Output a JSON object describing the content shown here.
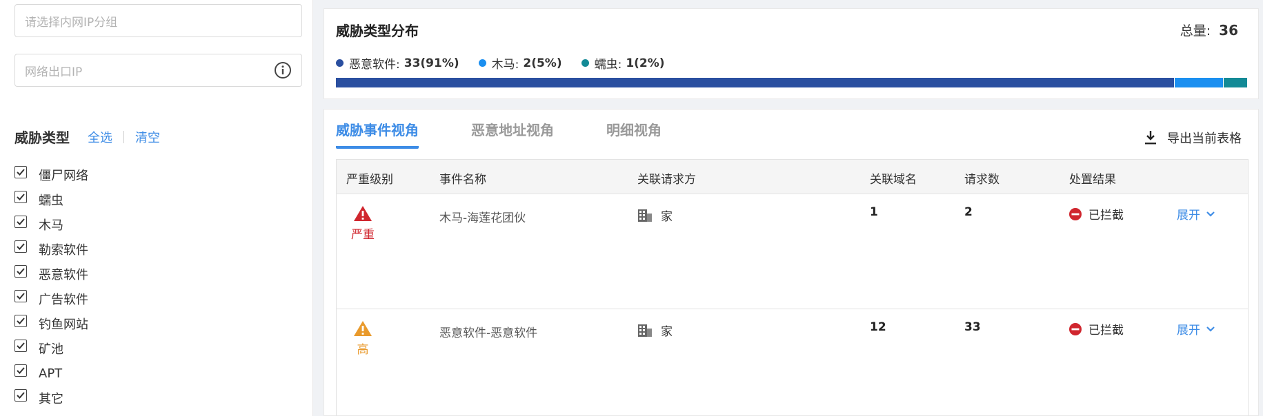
{
  "left_panel": {
    "ip_group_placeholder": "请选择内网IP分组",
    "egress_ip_placeholder": "网络出口IP",
    "filter_title": "威胁类型",
    "select_all": "全选",
    "clear": "清空",
    "threat_types": [
      {
        "label": "僵尸网络",
        "checked": true
      },
      {
        "label": "蠕虫",
        "checked": true
      },
      {
        "label": "木马",
        "checked": true
      },
      {
        "label": "勒索软件",
        "checked": true
      },
      {
        "label": "恶意软件",
        "checked": true
      },
      {
        "label": "广告软件",
        "checked": true
      },
      {
        "label": "钓鱼网站",
        "checked": true
      },
      {
        "label": "矿池",
        "checked": true
      },
      {
        "label": "APT",
        "checked": true
      },
      {
        "label": "其它",
        "checked": true
      }
    ]
  },
  "distribution": {
    "title": "威胁类型分布",
    "total_label": "总量:",
    "total_value": "36",
    "legend": [
      {
        "name": "恶意软件:",
        "value": "33(91%)",
        "color": "#2a4fa0",
        "fraction": 0.8045
      },
      {
        "name": "木马:",
        "value": "2(5%)",
        "color": "#1b8ff0",
        "fraction": 0.047
      },
      {
        "name": "蠕虫:",
        "value": "1(2%)",
        "color": "#138a96",
        "fraction": 0.0235
      }
    ]
  },
  "tabs": [
    {
      "label": "威胁事件视角",
      "active": true
    },
    {
      "label": "恶意地址视角",
      "active": false
    },
    {
      "label": "明细视角",
      "active": false
    }
  ],
  "export_label": "导出当前表格",
  "table": {
    "headers": [
      "严重级别",
      "事件名称",
      "关联请求方",
      "关联域名",
      "请求数",
      "处置结果"
    ],
    "rows": [
      {
        "severity": "严重",
        "severity_color": "#d0262e",
        "event": "木马-海莲花团伙",
        "requester": "家",
        "domains": "1",
        "requests": "2",
        "result": "已拦截",
        "expand": "展开"
      },
      {
        "severity": "高",
        "severity_color": "#e99a2c",
        "event": "恶意软件-恶意软件",
        "requester": "家",
        "domains": "12",
        "requests": "33",
        "result": "已拦截",
        "expand": "展开"
      }
    ]
  }
}
